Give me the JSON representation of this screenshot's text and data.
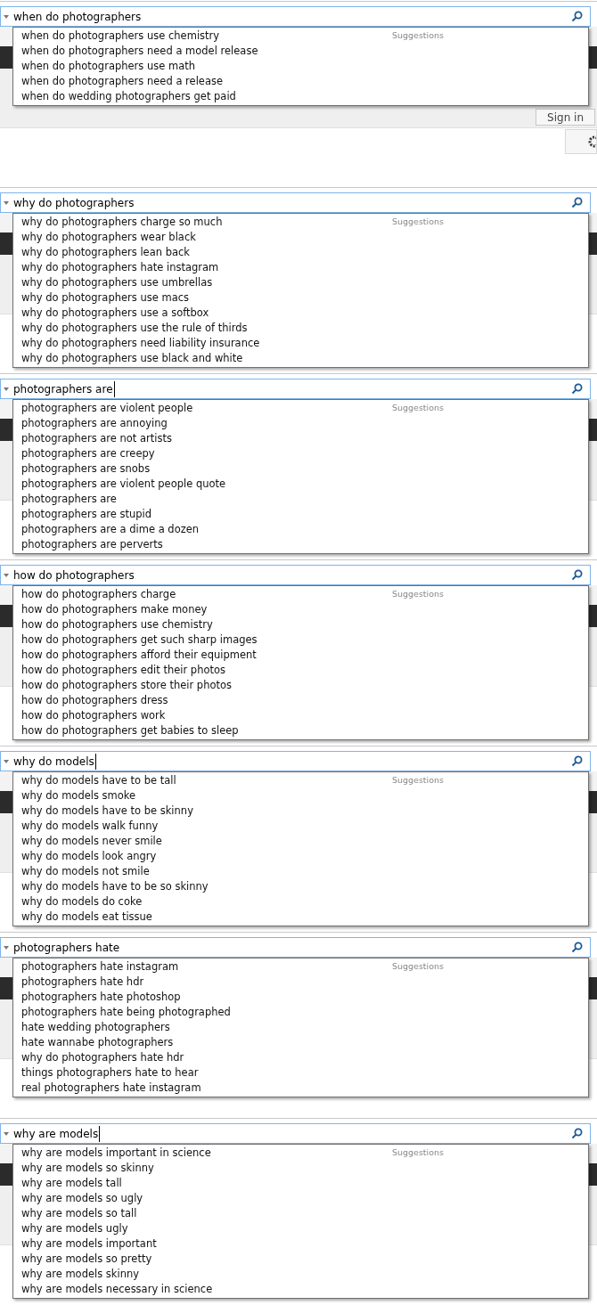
{
  "panels": [
    {
      "query": "when do photographers",
      "caret": false,
      "header": "Suggestions",
      "button": "Sign in",
      "suggestions": [
        "when do photographers use chemistry",
        "when do photographers need a model release",
        "when do photographers use math",
        "when do photographers need a release",
        "when do wedding photographers get paid"
      ]
    },
    {
      "query": "why do photographers",
      "caret": false,
      "header": "Suggestions",
      "suggestions": [
        "why do photographers charge so much",
        "why do photographers wear black",
        "why do photographers lean back",
        "why do photographers hate instagram",
        "why do photographers use umbrellas",
        "why do photographers use macs",
        "why do photographers use a softbox",
        "why do photographers use the rule of thirds",
        "why do photographers need liability insurance",
        "why do photographers use black and white"
      ]
    },
    {
      "query": "photographers are",
      "caret": true,
      "header": "Suggestions",
      "suggestions": [
        "photographers are violent people",
        "photographers are annoying",
        "photographers are not artists",
        "photographers are creepy",
        "photographers are snobs",
        "photographers are violent people quote",
        "photographers are",
        "photographers are stupid",
        "photographers are a dime a dozen",
        "photographers are perverts"
      ]
    },
    {
      "query": "how do photographers",
      "caret": false,
      "header": "Suggestions",
      "suggestions": [
        "how do photographers charge",
        "how do photographers make money",
        "how do photographers use chemistry",
        "how do photographers get such sharp images",
        "how do photographers afford their equipment",
        "how do photographers edit their photos",
        "how do photographers store their photos",
        "how do photographers dress",
        "how do photographers work",
        "how do photographers get babies to sleep"
      ]
    },
    {
      "query": "why do models",
      "caret": true,
      "header": "Suggestions",
      "suggestions": [
        "why do models have to be tall",
        "why do models smoke",
        "why do models have to be skinny",
        "why do models walk funny",
        "why do models never smile",
        "why do models look angry",
        "why do models not smile",
        "why do models have to be so skinny",
        "why do models do coke",
        "why do models eat tissue"
      ]
    },
    {
      "query": "photographers hate",
      "caret": false,
      "header": "Suggestions",
      "suggestions": [
        "photographers hate instagram",
        "photographers hate hdr",
        "photographers hate photoshop",
        "photographers hate being photographed",
        "hate wedding photographers",
        "hate wannabe photographers",
        "why do photographers hate hdr",
        "things photographers hate to hear",
        "real photographers hate instagram"
      ]
    },
    {
      "query": "why are models",
      "caret": true,
      "header": "Suggestions",
      "suggestions": [
        "why are models important in science",
        "why are models so skinny",
        "why are models tall",
        "why are models so ugly",
        "why are models so tall",
        "why are models ugly",
        "why are models important",
        "why are models so pretty",
        "why are models skinny",
        "why are models necessary in science"
      ]
    }
  ]
}
